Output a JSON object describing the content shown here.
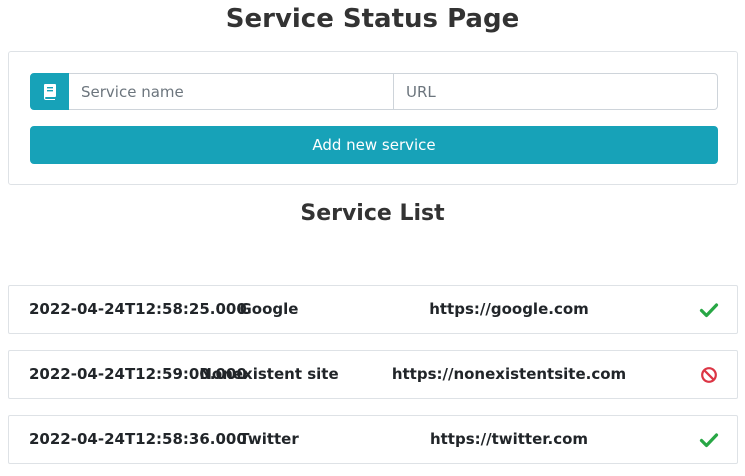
{
  "page": {
    "title": "Service Status Page"
  },
  "form": {
    "icon": "book-icon",
    "service_name_placeholder": "Service name",
    "url_placeholder": "URL",
    "add_button_label": "Add new service",
    "accent_color": "#17a2b8"
  },
  "service_list": {
    "title": "Service List",
    "items": [
      {
        "timestamp": "2022-04-24T12:58:25.000",
        "name": "Google",
        "url": "https://google.com",
        "status": "ok",
        "status_icon": "check-icon",
        "status_color": "#28a745"
      },
      {
        "timestamp": "2022-04-24T12:59:00.000",
        "name": "Nonexistent site",
        "url": "https://nonexistentsite.com",
        "status": "fail",
        "status_icon": "ban-icon",
        "status_color": "#dc3545"
      },
      {
        "timestamp": "2022-04-24T12:58:36.000",
        "name": "Twitter",
        "url": "https://twitter.com",
        "status": "ok",
        "status_icon": "check-icon",
        "status_color": "#28a745"
      }
    ]
  }
}
